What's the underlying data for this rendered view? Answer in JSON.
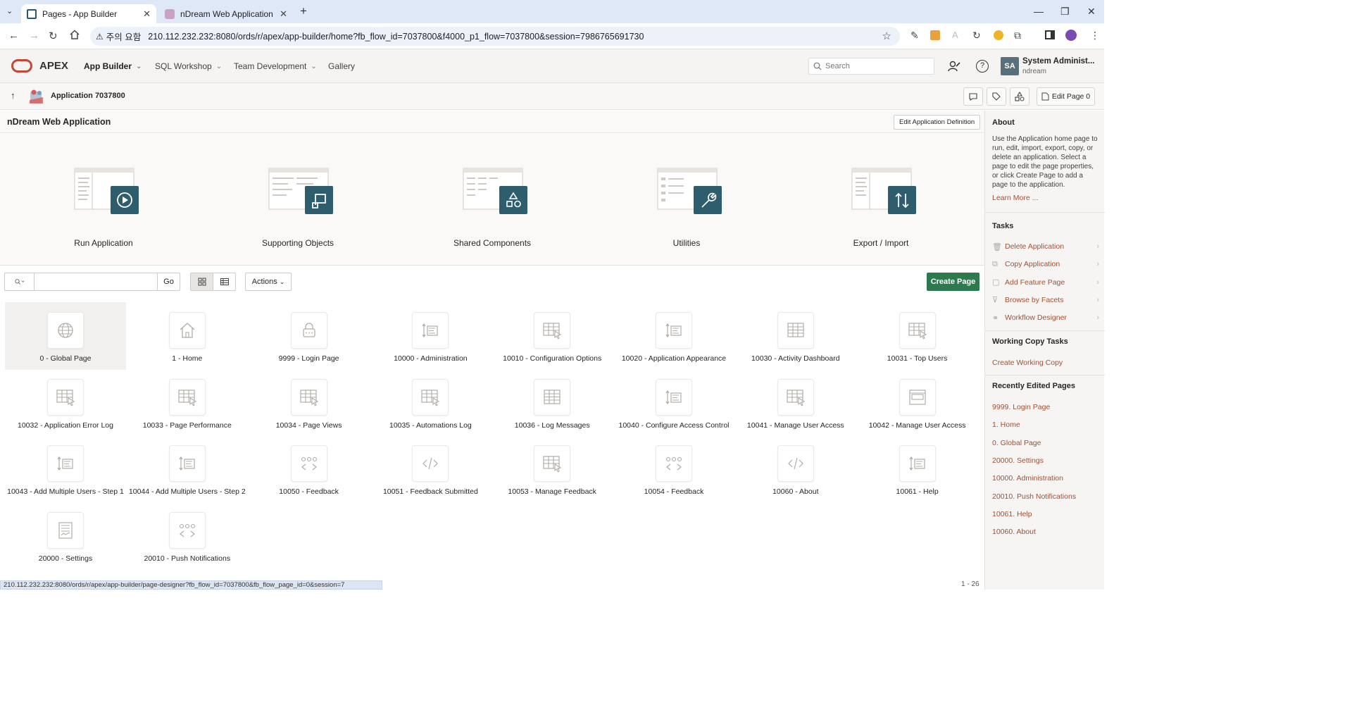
{
  "browser": {
    "tabs": [
      {
        "title": "Pages - App Builder",
        "active": true
      },
      {
        "title": "nDream Web Application",
        "active": false
      }
    ],
    "security_label": "주의 요함",
    "url": "210.112.232.232:8080/ords/r/apex/app-builder/home?fb_flow_id=7037800&f4000_p1_flow=7037800&session=7986765691730",
    "status_url": "210.112.232.232:8080/ords/r/apex/app-builder/page-designer?fb_flow_id=7037800&fb_flow_page_id=0&session=7"
  },
  "header": {
    "brand": "APEX",
    "nav": [
      {
        "label": "App Builder",
        "active": true,
        "dropdown": true
      },
      {
        "label": "SQL Workshop",
        "active": false,
        "dropdown": true
      },
      {
        "label": "Team Development",
        "active": false,
        "dropdown": true
      },
      {
        "label": "Gallery",
        "active": false,
        "dropdown": false
      }
    ],
    "search_placeholder": "Search",
    "user": {
      "initials": "SA",
      "name": "System Administ...",
      "workspace": "ndream"
    }
  },
  "breadcrumb": {
    "app_label": "Application 7037800",
    "edit_page_label": "Edit Page 0"
  },
  "main": {
    "app_title": "nDream Web Application",
    "edit_def_label": "Edit Application Definition",
    "hero": [
      {
        "label": "Run Application",
        "icon": "play-icon"
      },
      {
        "label": "Supporting Objects",
        "icon": "supporting-objects-icon"
      },
      {
        "label": "Shared Components",
        "icon": "shapes-icon"
      },
      {
        "label": "Utilities",
        "icon": "wrench-icon"
      },
      {
        "label": "Export / Import",
        "icon": "export-import-icon"
      }
    ],
    "toolbar": {
      "go_label": "Go",
      "actions_label": "Actions",
      "create_page_label": "Create Page"
    },
    "pages": [
      {
        "label": "0 - Global Page",
        "icon": "globe-icon",
        "selected": true
      },
      {
        "label": "1 - Home",
        "icon": "home-icon"
      },
      {
        "label": "9999 - Login Page",
        "icon": "lock-icon"
      },
      {
        "label": "10000 - Administration",
        "icon": "form-sort-icon"
      },
      {
        "label": "10010 - Configuration Options",
        "icon": "report-icon"
      },
      {
        "label": "10020 - Application Appearance",
        "icon": "form-sort-icon"
      },
      {
        "label": "10030 - Activity Dashboard",
        "icon": "table-icon"
      },
      {
        "label": "10031 - Top Users",
        "icon": "report-icon"
      },
      {
        "label": "10032 - Application Error Log",
        "icon": "report-icon"
      },
      {
        "label": "10033 - Page Performance",
        "icon": "report-icon"
      },
      {
        "label": "10034 - Page Views",
        "icon": "report-icon"
      },
      {
        "label": "10035 - Automations Log",
        "icon": "report-icon"
      },
      {
        "label": "10036 - Log Messages",
        "icon": "table-icon"
      },
      {
        "label": "10040 - Configure Access Control",
        "icon": "form-sort-icon"
      },
      {
        "label": "10041 - Manage User Access",
        "icon": "report-icon"
      },
      {
        "label": "10042 - Manage User Access",
        "icon": "modal-icon"
      },
      {
        "label": "10043 - Add Multiple Users - Step 1",
        "icon": "form-sort-icon"
      },
      {
        "label": "10044 - Add Multiple Users - Step 2",
        "icon": "form-sort-icon"
      },
      {
        "label": "10050 - Feedback",
        "icon": "wizard-icon"
      },
      {
        "label": "10051 - Feedback Submitted",
        "icon": "code-icon"
      },
      {
        "label": "10053 - Manage Feedback",
        "icon": "report-icon"
      },
      {
        "label": "10054 - Feedback",
        "icon": "wizard-icon"
      },
      {
        "label": "10060 - About",
        "icon": "code-icon"
      },
      {
        "label": "10061 - Help",
        "icon": "form-sort-icon"
      },
      {
        "label": "20000 - Settings",
        "icon": "settings-form-icon"
      },
      {
        "label": "20010 - Push Notifications",
        "icon": "wizard-icon"
      }
    ],
    "count_label": "1 - 26"
  },
  "sidebar": {
    "about_title": "About",
    "about_text": "Use the Application home page to run, edit, import, export, copy, or delete an application. Select a page to edit the page properties, or click Create Page to add a page to the application.",
    "learn_more": "Learn More ...",
    "tasks_title": "Tasks",
    "tasks": [
      {
        "label": "Delete Application",
        "icon": "trash-icon"
      },
      {
        "label": "Copy Application",
        "icon": "copy-icon"
      },
      {
        "label": "Add Feature Page",
        "icon": "add-page-icon"
      },
      {
        "label": "Browse by Facets",
        "icon": "filter-icon"
      },
      {
        "label": "Workflow Designer",
        "icon": "workflow-icon"
      }
    ],
    "working_copy_title": "Working Copy Tasks",
    "working_copy_link": "Create Working Copy",
    "recent_title": "Recently Edited Pages",
    "recent": [
      "9999. Login Page",
      "1. Home",
      "0. Global Page",
      "20000. Settings",
      "10000. Administration",
      "20010. Push Notifications",
      "10061. Help",
      "10060. About"
    ]
  },
  "colors": {
    "accent": "#2e5e6e",
    "create_button": "#2e7a4f",
    "link": "#a84e2e",
    "brand_red": "#c74634"
  }
}
